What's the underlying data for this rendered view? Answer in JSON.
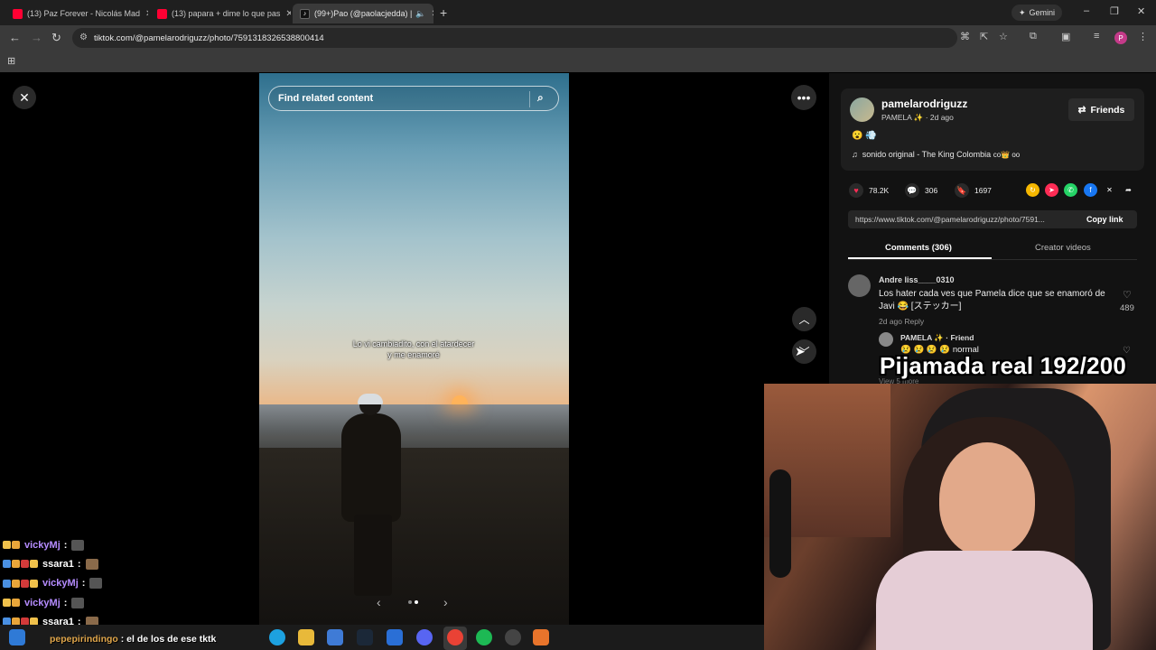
{
  "browser": {
    "tabs": [
      {
        "label": "(13) Paz Forever - Nicolás Mad",
        "icon": "youtube-icon"
      },
      {
        "label": "(13) papara + dime lo que pas",
        "icon": "youtube-icon"
      },
      {
        "label": "(99+)Pao (@paolacjedda) |",
        "icon": "tiktok-icon"
      }
    ],
    "gemini_label": "Gemini",
    "url": "tiktok.com/@pamelarodriguzz/photo/7591318326538800414",
    "profile_initial": "P"
  },
  "viewer": {
    "search_placeholder": "Find related content",
    "caption_line1": "Lo vi cambiadito, con el atardecer",
    "caption_line2": "y me enamoré"
  },
  "post": {
    "username": "pamelarodriguzz",
    "display_meta": "PAMELA ✨ · 2d ago",
    "friends_label": "Friends",
    "description": "😮 💨",
    "music": "sonido original - The King Colombia",
    "music_tail": "co👑 oo",
    "likes": "78.2K",
    "comments": "306",
    "saves": "1697",
    "link": "https://www.tiktok.com/@pamelarodriguzz/photo/7591...",
    "copy_link_label": "Copy link",
    "tab_comments": "Comments (306)",
    "tab_creator": "Creator videos"
  },
  "comments": [
    {
      "user": "Andre liss____0310",
      "text": "Los hater cada ves que Pamela dice que se enamoró de Javi 😂 [ステッカー]",
      "meta": "2d ago    Reply",
      "likes": "489",
      "reply": {
        "user": "PAMELA ✨ · Friend",
        "text": "😢 😢 😢 😢 normal"
      },
      "view_more": "View 5 more"
    }
  ],
  "stream": {
    "overlay_title": "Pijamada real 192/200",
    "chat": [
      {
        "user": "vickyMj",
        "color": "#b58cff"
      },
      {
        "user": "ssara1",
        "color": "#ffffff"
      },
      {
        "user": "vickyMj",
        "color": "#b58cff"
      },
      {
        "user": "vickyMj",
        "color": "#b58cff"
      },
      {
        "user": "ssara1",
        "color": "#ffffff"
      }
    ],
    "chat_separator": ":",
    "ticker_user": "pepepirindingo",
    "ticker_text": "el de los  de ese tktk"
  }
}
